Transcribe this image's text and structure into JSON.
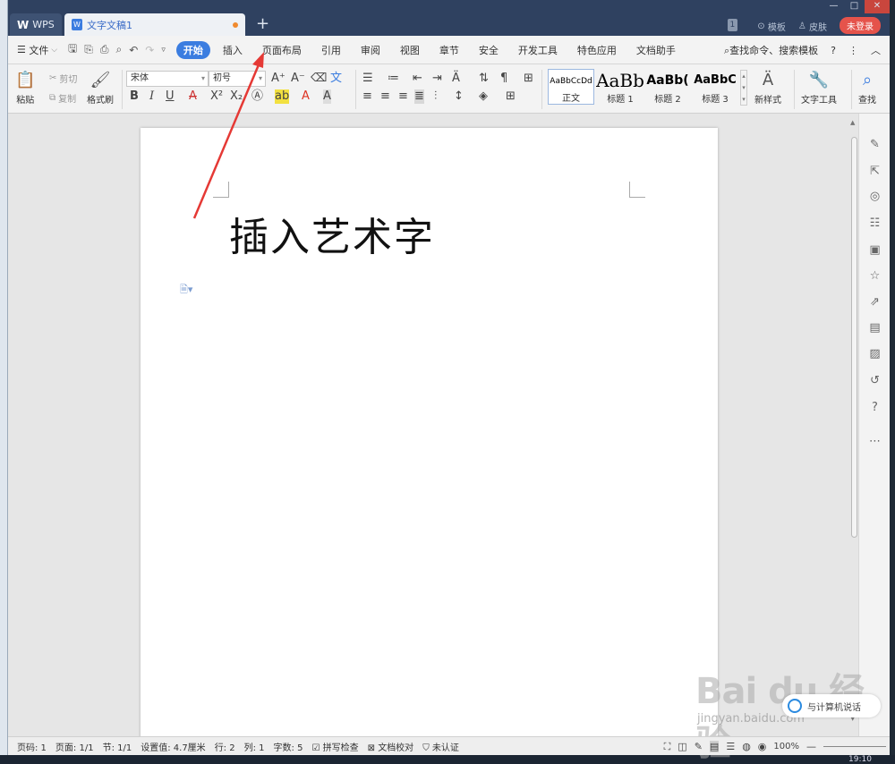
{
  "titlebar": {
    "wps_tab": "WPS",
    "doc_tab": "文字文稿1",
    "new_tab": "+",
    "page_badge": "1",
    "template": "模板",
    "skin": "皮肤",
    "login": "未登录"
  },
  "menubar": {
    "file": "文件",
    "tabs": [
      "开始",
      "插入",
      "页面布局",
      "引用",
      "审阅",
      "视图",
      "章节",
      "安全",
      "开发工具",
      "特色应用",
      "文档助手"
    ],
    "search": "查找命令、搜索模板"
  },
  "ribbon": {
    "paste": "粘贴",
    "cut": "剪切",
    "copy": "复制",
    "format_painter": "格式刷",
    "font_name": "宋体",
    "font_size": "初号",
    "styles": [
      {
        "sample": "AaBbCcDd",
        "name": "正文"
      },
      {
        "sample": "AaBb",
        "name": "标题 1"
      },
      {
        "sample": "AaBb(",
        "name": "标题 2"
      },
      {
        "sample": "AaBbC",
        "name": "标题 3"
      }
    ],
    "new_style": "新样式",
    "text_tools": "文字工具",
    "find": "查找"
  },
  "document": {
    "text": "插入艺术字"
  },
  "statusbar": {
    "page_no": "页码: 1",
    "pages": "页面: 1/1",
    "section": "节: 1/1",
    "setting": "设置值: 4.7厘米",
    "row": "行: 2",
    "col": "列: 1",
    "words": "字数: 5",
    "spell": "拼写检查",
    "doc_check": "文档校对",
    "cert": "未认证",
    "zoom": "100%"
  },
  "watermark": {
    "brand": "Bai du 经验",
    "sub": "jingyan.baidu.com",
    "bubble": "与计算机说话"
  },
  "system": {
    "clock": "19:10"
  },
  "colors": {
    "title_bg": "#2f4160",
    "accent": "#3b7de0",
    "login_red": "#e5534b",
    "arrow": "#e53935"
  }
}
